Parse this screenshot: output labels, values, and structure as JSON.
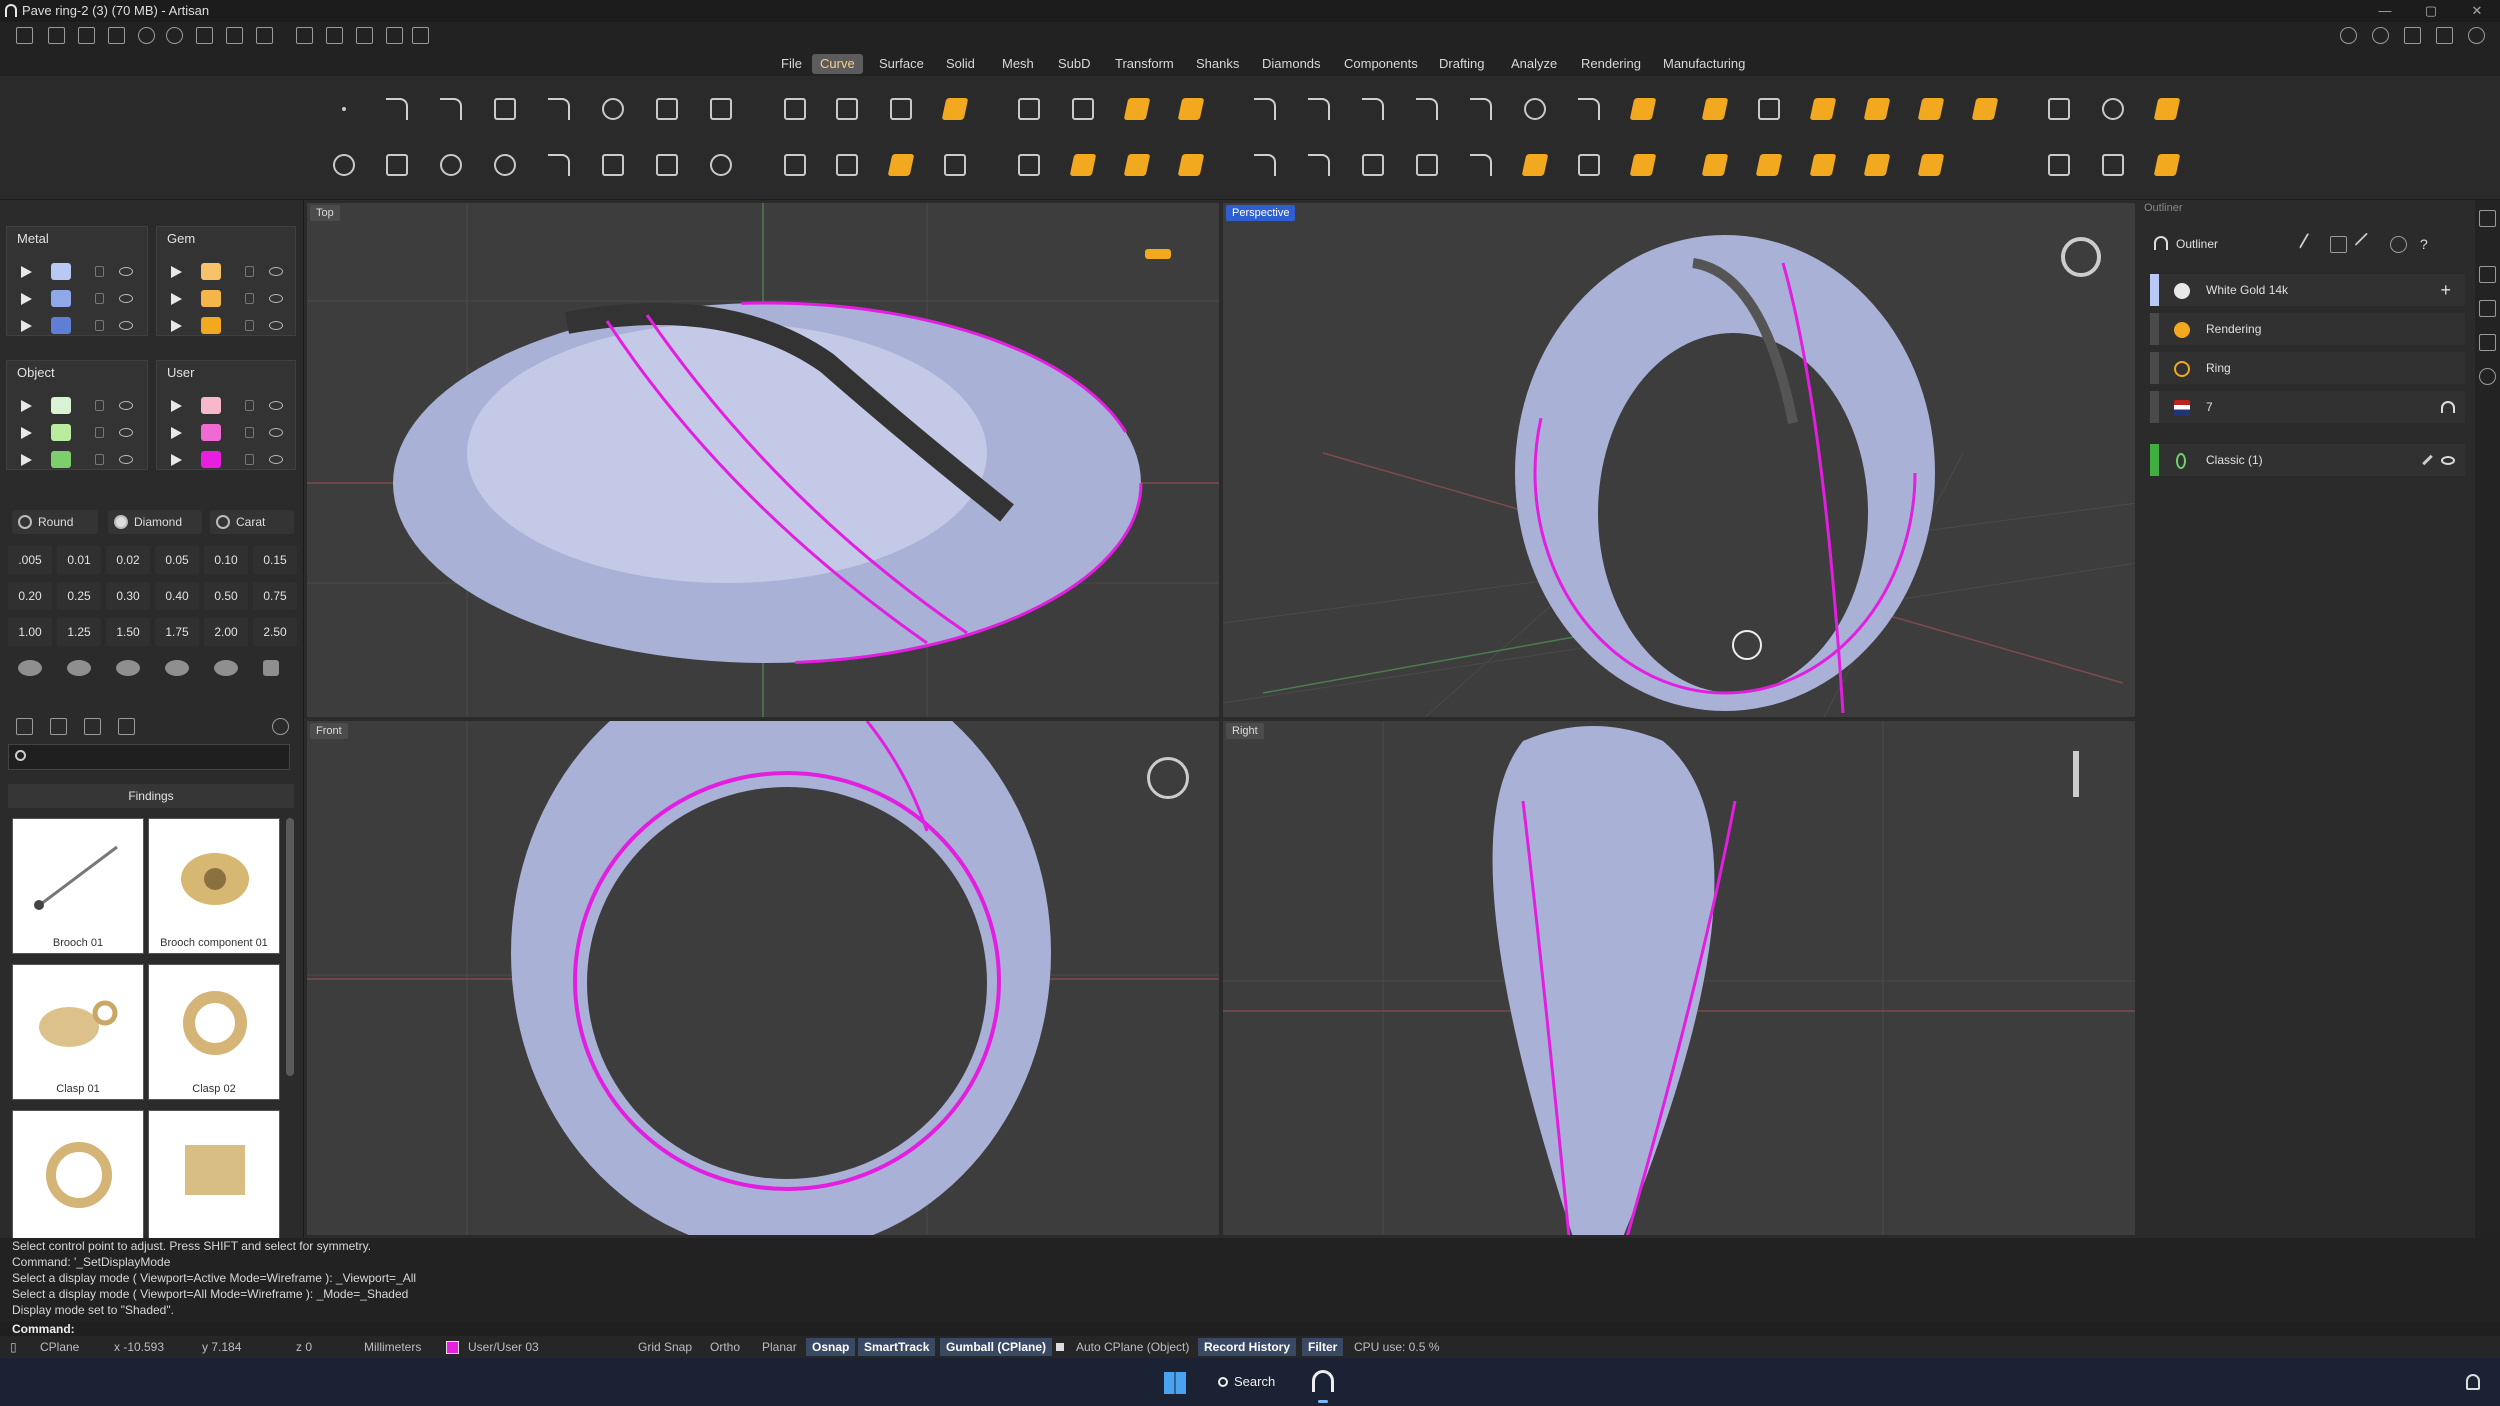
{
  "window": {
    "title": "Pave ring-2 (3) (70 MB) - Artisan"
  },
  "menu": [
    "File",
    "Curve",
    "Surface",
    "Solid",
    "Mesh",
    "SubD",
    "Transform",
    "Shanks",
    "Diamonds",
    "Components",
    "Drafting",
    "Analyze",
    "Rendering",
    "Manufacturing"
  ],
  "menu_active": "Curve",
  "layers": {
    "metal_title": "Metal",
    "gem_title": "Gem",
    "object_title": "Object",
    "user_title": "User",
    "metal_colors": [
      "#b9c8f5",
      "#8fa8e8",
      "#5f7ed6"
    ],
    "gem_colors": [
      "#f6c36a",
      "#f4b64a",
      "#f2a81f"
    ],
    "object_colors": [
      "#d9f2d4",
      "#b9ec9f",
      "#7ccf6a"
    ],
    "user_colors": [
      "#f7b8cc",
      "#f06ad4",
      "#e81ee0"
    ]
  },
  "gems": {
    "shape_label": "Round",
    "type_label": "Diamond",
    "unit_label": "Carat",
    "carats": [
      ".005",
      "0.01",
      "0.02",
      "0.05",
      "0.10",
      "0.15",
      "0.20",
      "0.25",
      "0.30",
      "0.40",
      "0.50",
      "0.75",
      "1.00",
      "1.25",
      "1.50",
      "1.75",
      "2.00",
      "2.50"
    ]
  },
  "library": {
    "search_placeholder": "",
    "category": "Findings",
    "items": [
      "Brooch 01",
      "Brooch component 01",
      "Clasp 01",
      "Clasp 02",
      "",
      ""
    ]
  },
  "viewports": {
    "top": "Top",
    "perspective": "Perspective",
    "front": "Front",
    "right": "Right"
  },
  "outliner": {
    "title": "Outliner",
    "panel_label": "Outliner",
    "rows": [
      {
        "label": "White Gold 14k",
        "color": "#b9c8f5"
      },
      {
        "label": "Rendering",
        "color": "#4a4a4a"
      },
      {
        "label": "Ring",
        "color": "#4a4a4a"
      },
      {
        "label": "7",
        "color": "#4a4a4a"
      },
      {
        "label": "Classic (1)",
        "color": "#3fb03f"
      }
    ]
  },
  "command_history": [
    "Select control point to adjust. Press SHIFT and select for symmetry.",
    "Command: '_SetDisplayMode",
    "Select a display mode ( Viewport=Active  Mode=Wireframe ): _Viewport=_All",
    "Select a display mode ( Viewport=All  Mode=Wireframe ): _Mode=_Shaded",
    "Display mode set to \"Shaded\"."
  ],
  "command_prompt": "Command:",
  "status": {
    "cplane": "CPlane",
    "x": "x -10.593",
    "y": "y 7.184",
    "z": "z 0",
    "units": "Millimeters",
    "layer": "User/User 03",
    "grid_snap": "Grid Snap",
    "ortho": "Ortho",
    "planar": "Planar",
    "osnap": "Osnap",
    "smarttrack": "SmartTrack",
    "gumball": "Gumball (CPlane)",
    "auto_cplane": "Auto CPlane (Object)",
    "record_history": "Record History",
    "filter": "Filter",
    "cpu": "CPU use: 0.5 %"
  },
  "taskbar": {
    "search": "Search"
  },
  "colors": {
    "accent_active_menu": "#f4d08a",
    "selection_curve": "#e31ee0",
    "viewport_active": "#2e5fd0",
    "toolbar_orange": "#f2a81f"
  }
}
